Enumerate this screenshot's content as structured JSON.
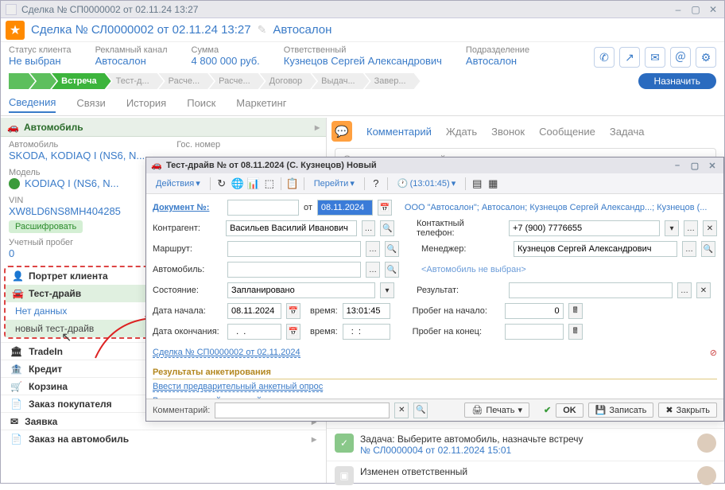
{
  "main_window": {
    "title": "Сделка № СП0000002 от 02.11.24 13:27",
    "deal_title": "Сделка № СЛ0000002 от 02.11.24 13:27",
    "deal_sub": "Автосалон"
  },
  "stats": {
    "status_label": "Статус клиента",
    "status_val": "Не выбран",
    "adchannel_label": "Рекламный канал",
    "adchannel_val": "Автосалон",
    "sum_label": "Сумма",
    "sum_val": "4 800 000 руб.",
    "resp_label": "Ответственный",
    "resp_val": "Кузнецов Сергей Александрович",
    "dept_label": "Подразделение",
    "dept_val": "Автосалон"
  },
  "stages": [
    "",
    "",
    "Встреча",
    "Тест-д...",
    "Расче...",
    "Расче...",
    "Договор",
    "Выдач...",
    "Завер..."
  ],
  "assign_label": "Назначить",
  "main_tabs": [
    "Сведения",
    "Связи",
    "История",
    "Поиск",
    "Маркетинг"
  ],
  "auto_section": {
    "title": "Автомобиль",
    "auto_label": "Автомобиль",
    "auto_val": "SKODA, KODIAQ I (NS6, N...",
    "gos_label": "Гос. номер",
    "model_label": "Модель",
    "model_val": "KODIAQ I (NS6, N...",
    "vin_label": "VIN",
    "vin_val": "XW8LD6NS8MH404285",
    "decode": "Расшифровать",
    "mileage_label": "Учетный пробег",
    "mileage_val": "0"
  },
  "side_sections": {
    "portrait": "Портрет клиента",
    "testdrive": "Тест-драйв",
    "no_data": "Нет данных",
    "new_td": "новый тест-драйв",
    "tradein": "TradeIn",
    "credit": "Кредит",
    "basket": "Корзина",
    "buyer_order": "Заказ покупателя",
    "request": "Заявка",
    "auto_order": "Заказ на автомобиль"
  },
  "right_pane": {
    "tabs": [
      "Комментарий",
      "Ждать",
      "Звонок",
      "Сообщение",
      "Задача"
    ],
    "placeholder": "Оставьте комментарий ...",
    "task_text": "Задача: Выберите автомобиль, назначьте встречу",
    "task_link": "№ СЛ0000004 от 02.11.2024 15:01",
    "changed": "Изменен ответственный"
  },
  "popup": {
    "title": "Тест-драйв №  от 08.11.2024 (С. Кузнецов) Новый",
    "tb_actions": "Действия",
    "tb_goto": "Перейти",
    "tb_time": "(13:01:45)",
    "doc_label": "Документ №:",
    "ot": "от",
    "date_val": "08.11.2024",
    "org_link": "ООО \"Автосалон\"; Автосалон; Кузнецов Сергей Александр...; Кузнецов (...",
    "contr_label": "Контрагент:",
    "contr_val": "Васильев Василий Иванович",
    "phone_label": "Контактный телефон:",
    "phone_val": "+7 (900) 7776655",
    "route_label": "Маршрут:",
    "manager_label": "Менеджер:",
    "manager_val": "Кузнецов Сергей Александрович",
    "auto_label": "Автомобиль:",
    "auto_placeholder": "<Автомобиль не выбран>",
    "state_label": "Состояние:",
    "state_val": "Запланировано",
    "result_label": "Результат:",
    "dstart_label": "Дата начала:",
    "dstart_val": "08.11.2024",
    "time_label": "время:",
    "time_val": "13:01:45",
    "miles_start_label": "Пробег на начало:",
    "miles_start_val": "0",
    "dend_label": "Дата окончания:",
    "dend_val": "  .  .    ",
    "time2_val": "  :  :  ",
    "miles_end_label": "Пробег на конец:",
    "deal_link": "Сделка № СП0000002 от 02.11.2024",
    "survey_title": "Результаты анкетирования",
    "survey_pre": "Ввести предварительный анкетный опрос",
    "survey_post": "Ввести итоговый анкетный опрос",
    "comment_label": "Комментарий:",
    "print": "Печать",
    "ok": "OK",
    "save": "Записать",
    "close": "Закрыть"
  }
}
